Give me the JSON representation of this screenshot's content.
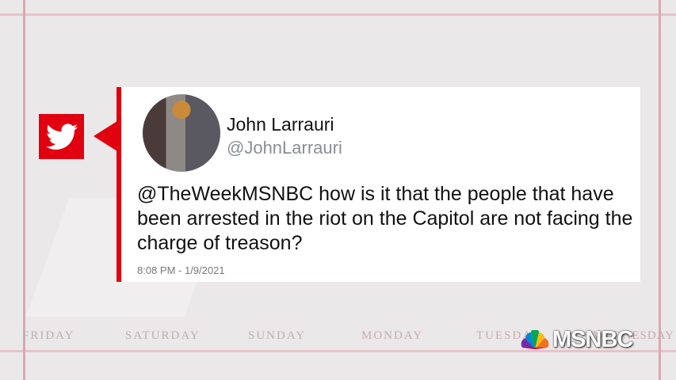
{
  "tweet": {
    "name": "John Larrauri",
    "handle": "@JohnLarrauri",
    "text": "@TheWeekMSNBC how is it that the people that have been arrested in the riot on the Capitol are not facing the charge of treason?",
    "timestamp": "8:08 PM - 1/9/2021"
  },
  "days": [
    "FRIDAY",
    "SATURDAY",
    "SUNDAY",
    "MONDAY",
    "TUESDAY",
    "WEDNESDAY"
  ],
  "logo": {
    "text": "MSNBC"
  },
  "colors": {
    "accent": "#e0000f",
    "background": "#ebe8e9"
  }
}
